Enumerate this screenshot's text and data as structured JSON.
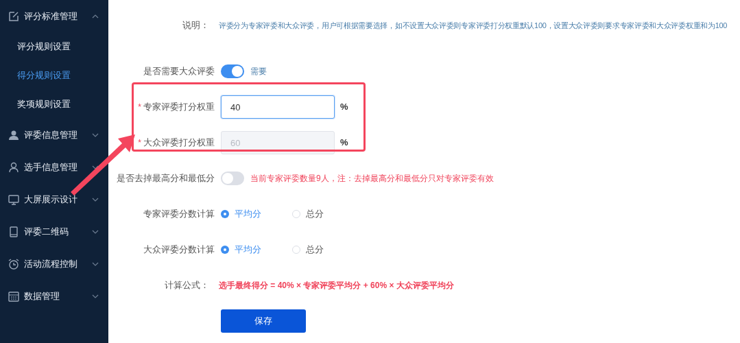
{
  "sidebar": {
    "items": [
      {
        "label": "评分标准管理",
        "expanded": true,
        "children": [
          {
            "label": "评分规则设置",
            "selected": false
          },
          {
            "label": "得分规则设置",
            "selected": true
          },
          {
            "label": "奖项规则设置",
            "selected": false
          }
        ]
      },
      {
        "label": "评委信息管理",
        "expanded": false
      },
      {
        "label": "选手信息管理",
        "expanded": false
      },
      {
        "label": "大屏展示设计",
        "expanded": false
      },
      {
        "label": "评委二维码",
        "expanded": false
      },
      {
        "label": "活动流程控制",
        "expanded": false
      },
      {
        "label": "数据管理",
        "expanded": false
      }
    ]
  },
  "form": {
    "description": {
      "label": "说明：",
      "text": "评委分为专家评委和大众评委，用户可根据需要选择，如不设置大众评委则专家评委打分权重默认100，设置大众评委则要求专家评委和大众评委权重和为100"
    },
    "rows": [
      {
        "kind": "switch",
        "label": "是否需要大众评委",
        "on": true,
        "note": "需要",
        "warning": false
      },
      {
        "kind": "input",
        "label": "专家评委打分权重",
        "required_mark": "*",
        "value": "40",
        "disabled": false,
        "focused": true,
        "unit": "%"
      },
      {
        "kind": "input",
        "label": "大众评委打分权重",
        "required_mark": "*",
        "value": "60",
        "disabled": true,
        "unit": "%"
      },
      {
        "kind": "switch",
        "label": "是否去掉最高分和最低分",
        "on": false,
        "note": "当前专家评委数量9人，注：去掉最高分和最低分只对专家评委有效",
        "warning": true
      },
      {
        "kind": "radio",
        "label": "专家评委分数计算",
        "options": [
          {
            "label": "平均分",
            "selected": true
          },
          {
            "label": "总分",
            "selected": false
          }
        ]
      },
      {
        "kind": "radio",
        "label": "大众评委分数计算",
        "options": [
          {
            "label": "平均分",
            "selected": true
          },
          {
            "label": "总分",
            "selected": false
          }
        ]
      },
      {
        "kind": "formula",
        "label": "计算公式：",
        "text": "选手最终得分 = 40% × 专家评委平均分 + 60% × 大众评委平均分"
      }
    ],
    "save_button": "保存"
  }
}
